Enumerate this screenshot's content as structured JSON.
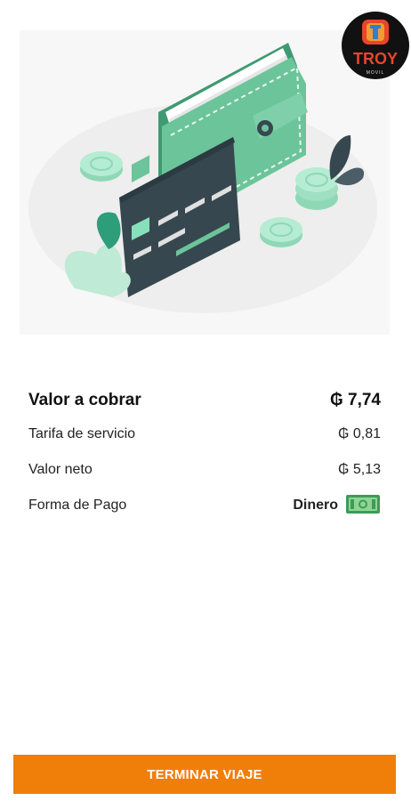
{
  "logo": {
    "name": "TROY",
    "tagline": "MOVIL"
  },
  "illustration": {
    "icon": "wallet-card-coins-illustration"
  },
  "summary": {
    "total_label": "Valor a cobrar",
    "total_value": "₲ 7,74",
    "rows": [
      {
        "label": "Tarifa de servicio",
        "value": "₲ 0,81"
      },
      {
        "label": "Valor neto",
        "value": "₲ 5,13"
      }
    ],
    "payment_label": "Forma de Pago",
    "payment_method": "Dinero",
    "payment_icon": "cash-bill-icon"
  },
  "actions": {
    "finish_label": "TERMINAR VIAJE"
  },
  "colors": {
    "accent": "#f07f0a",
    "green": "#6cc49a",
    "dark": "#37474f"
  }
}
